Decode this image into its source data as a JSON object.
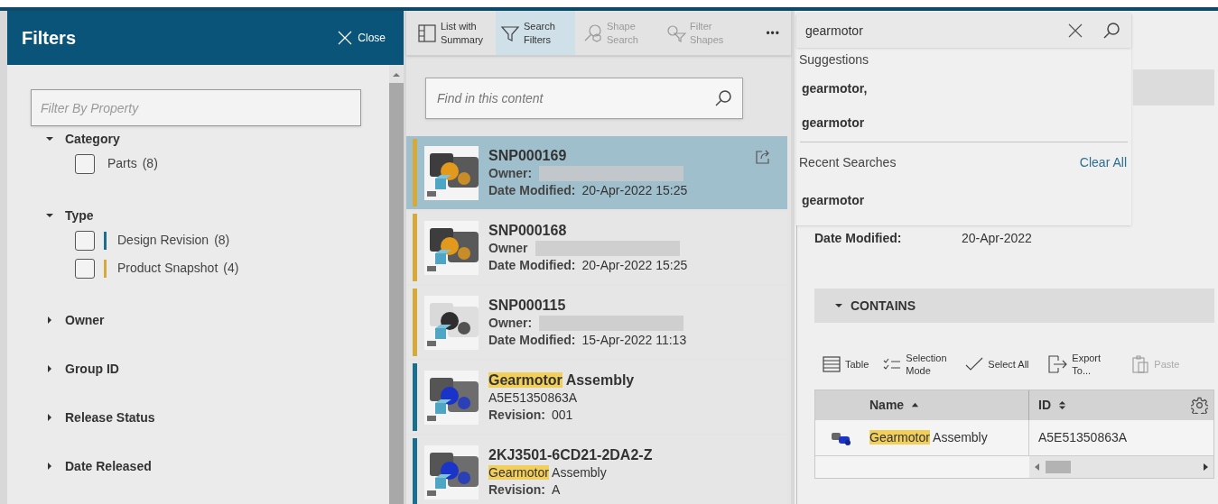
{
  "filters_panel": {
    "title": "Filters",
    "close": "Close",
    "search": {
      "placeholder": "Filter By Property"
    },
    "groups": [
      {
        "label": "Category",
        "expanded": true,
        "options": [
          {
            "label": "Parts",
            "count": "(8)",
            "checked": false
          }
        ]
      },
      {
        "label": "Type",
        "expanded": true,
        "options": [
          {
            "label": "Design Revision",
            "count": "(8)",
            "checked": false,
            "color": "#1a6f8e"
          },
          {
            "label": "Product Snapshot",
            "count": "(4)",
            "checked": false,
            "color": "#d6aa3a"
          }
        ]
      },
      {
        "label": "Owner",
        "expanded": false
      },
      {
        "label": "Group ID",
        "expanded": false
      },
      {
        "label": "Release Status",
        "expanded": false
      },
      {
        "label": "Date Released",
        "expanded": false
      }
    ]
  },
  "content_panel": {
    "toolbar": [
      {
        "kind": "layout",
        "label": "List with Summary",
        "selected": false,
        "disabled": false
      },
      {
        "kind": "filter",
        "label": "Search Filters",
        "selected": true,
        "disabled": false
      },
      {
        "kind": "shape_search",
        "label": "Shape Search",
        "selected": false,
        "disabled": true
      },
      {
        "kind": "filter_shapes",
        "label": "Filter Shapes",
        "selected": false,
        "disabled": true
      }
    ],
    "more": "•••",
    "search": {
      "placeholder": "Find in this content"
    },
    "results": [
      {
        "color": "#d6aa3a",
        "selected": true,
        "title": [
          {
            "text": "SNP000169",
            "highlighted": false
          }
        ],
        "lines": [
          {
            "kind": "field",
            "label": "Owner:",
            "redacted": true
          },
          {
            "kind": "field",
            "label": "Date Modified:",
            "value": "20-Apr-2022 15:25"
          }
        ]
      },
      {
        "color": "#d6aa3a",
        "selected": false,
        "title": [
          {
            "text": "SNP000168",
            "highlighted": false
          }
        ],
        "lines": [
          {
            "kind": "field",
            "label": "Owner",
            "redacted": true
          },
          {
            "kind": "field",
            "label": "Date Modified:",
            "value": "20-Apr-2022 15:25"
          }
        ]
      },
      {
        "color": "#d6aa3a",
        "selected": false,
        "title": [
          {
            "text": "SNP000115",
            "highlighted": false
          }
        ],
        "lines": [
          {
            "kind": "field",
            "label": "Owner:",
            "redacted": true
          },
          {
            "kind": "field",
            "label": "Date Modified:",
            "value": "15-Apr-2022 11:13"
          }
        ]
      },
      {
        "color": "#1a6f8e",
        "selected": false,
        "title": [
          {
            "text": "Gearmotor",
            "highlighted": true
          },
          {
            "text": " Assembly",
            "highlighted": false
          }
        ],
        "lines": [
          {
            "kind": "text",
            "parts": [
              {
                "text": "A5E51350863A",
                "highlighted": false
              }
            ]
          },
          {
            "kind": "field",
            "label": "Revision:",
            "value": "001"
          }
        ]
      },
      {
        "color": "#1a6f8e",
        "selected": false,
        "title": [
          {
            "text": "2KJ3501-6CD21-2DA2-Z",
            "highlighted": false
          }
        ],
        "lines": [
          {
            "kind": "text",
            "parts": [
              {
                "text": "Gearmotor",
                "highlighted": true
              },
              {
                "text": " Assembly",
                "highlighted": false
              }
            ]
          },
          {
            "kind": "field",
            "label": "Revision:",
            "value": "A"
          }
        ]
      }
    ]
  },
  "detail_panel": {
    "search": {
      "value": "gearmotor"
    },
    "dropdown": {
      "suggestions_header": "Suggestions",
      "suggestions": [
        "gearmotor,",
        "gearmotor"
      ],
      "recent_header": "Recent Searches",
      "clear_all": "Clear All",
      "recent": [
        "gearmotor"
      ]
    },
    "date_modified": {
      "label": "Date Modified:",
      "value": "20-Apr-2022"
    },
    "section": {
      "title": "CONTAINS",
      "expanded": true
    },
    "toolbar": [
      {
        "kind": "table",
        "label": "Table",
        "disabled": false
      },
      {
        "kind": "selection",
        "label": "Selection Mode",
        "disabled": false
      },
      {
        "kind": "check",
        "label": "Select All",
        "disabled": false
      },
      {
        "kind": "export",
        "label": "Export To...",
        "disabled": false
      },
      {
        "kind": "paste",
        "label": "Paste",
        "disabled": true
      }
    ],
    "table": {
      "columns": [
        {
          "label": "Name",
          "sorted": true,
          "ascending": true
        },
        {
          "label": "ID",
          "sorted": false
        }
      ],
      "rows": [
        {
          "name": [
            {
              "text": "Gearmotor",
              "highlighted": true
            },
            {
              "text": " Assembly",
              "highlighted": false
            }
          ],
          "id": "A5E51350863A"
        }
      ]
    }
  }
}
